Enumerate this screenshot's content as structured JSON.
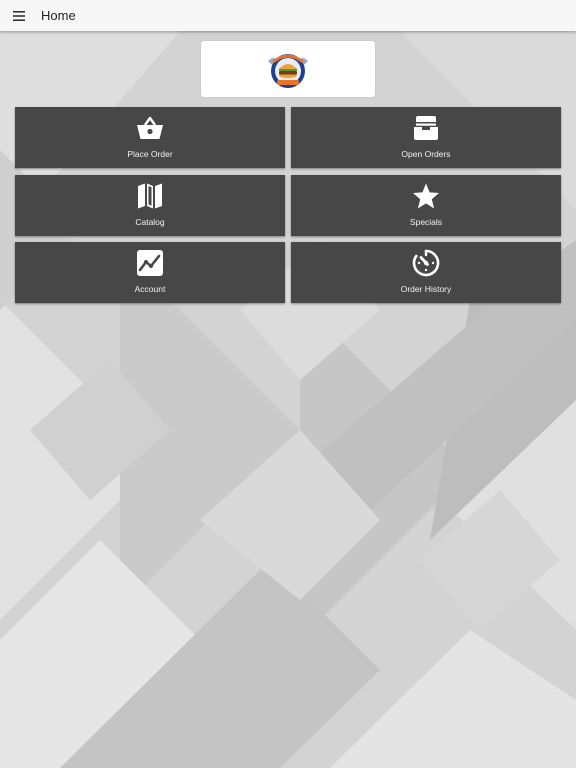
{
  "header": {
    "title": "Home",
    "menu_icon": "hamburger-menu-icon"
  },
  "logo": {
    "top_text": "JoeBoe",
    "bottom_text": "FOOD SERVICE",
    "colors": {
      "navy": "#1f3f8f",
      "orange": "#e8742a",
      "burger_bun": "#f0a23a",
      "burger_patty": "#7a3b18"
    }
  },
  "tiles": [
    {
      "label": "Place Order",
      "icon": "basket-icon"
    },
    {
      "label": "Open Orders",
      "icon": "inbox-tray-icon"
    },
    {
      "label": "Catalog",
      "icon": "map-icon"
    },
    {
      "label": "Specials",
      "icon": "star-icon"
    },
    {
      "label": "Account",
      "icon": "trending-chart-icon"
    },
    {
      "label": "Order History",
      "icon": "clock-history-icon"
    }
  ],
  "colors": {
    "tile_background": "#474747",
    "tile_text": "#f2f2f2",
    "app_bar": "#f7f7f7",
    "background": "#d4d4d4"
  }
}
